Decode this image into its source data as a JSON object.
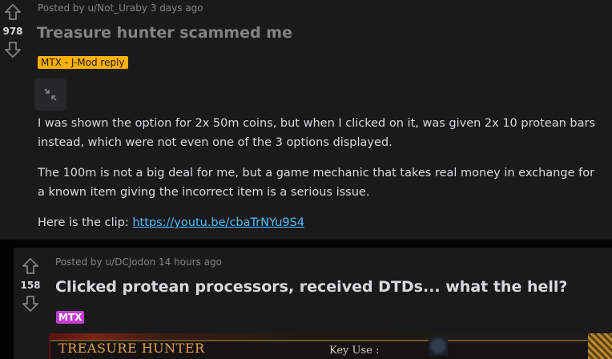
{
  "post1": {
    "score": "978",
    "posted_by": "Posted by u/Not_Uraby 3 days ago",
    "title": "Treasure hunter scammed me",
    "flair": "MTX - J-Mod reply",
    "body": {
      "p1": "I was shown the option for 2x 50m coins, but when I clicked on it, was given 2x 10 protean bars instead, which were not even one of the 3 options displayed.",
      "p2": "The 100m is not a big deal for me, but a game mechanic that takes real money in exchange for a known item giving the incorrect item is a serious issue.",
      "p3_prefix": "Here is the clip: ",
      "link": "https://youtu.be/cbaTrNYu9S4"
    }
  },
  "post2": {
    "score": "158",
    "posted_by": "Posted by u/DCJodon 14 hours ago",
    "title": "Clicked protean processors, received DTDs... what the hell?",
    "flair": "MTX",
    "preview": {
      "title": "TREASURE HUNTER",
      "key_label": "Key Use :"
    }
  },
  "icons": {
    "upvote": "upvote-arrow-icon",
    "downvote": "downvote-arrow-icon",
    "collapse": "collapse-arrows-icon"
  },
  "colors": {
    "background": "#1a1a1b",
    "title_read": "#818384",
    "title_unread": "#d7dadc",
    "jmod_flair": "#ffb000",
    "mtx_flair": "#c13ed1",
    "link": "#4fbcff"
  }
}
